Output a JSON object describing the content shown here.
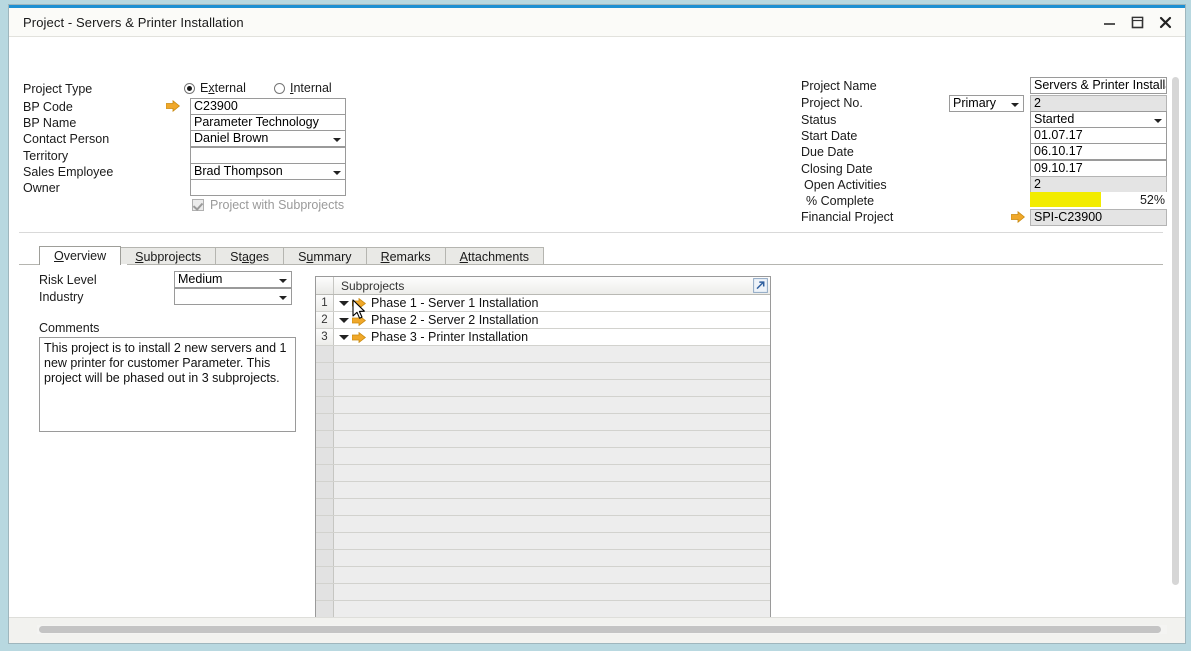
{
  "window": {
    "title": "Project - Servers & Printer Installation",
    "controls": {
      "minimize": "Minimize",
      "maximize": "Maximize",
      "close": "Close"
    },
    "accent_color": "#1e90d2",
    "desktop_color": "#b8d8e0"
  },
  "form_left": {
    "project_type": {
      "label": "Project Type",
      "options": [
        {
          "label": "External",
          "mnemonic": "x",
          "selected": true
        },
        {
          "label": "Internal",
          "mnemonic": "I",
          "selected": false
        }
      ]
    },
    "bp_code": {
      "label": "BP Code",
      "value": "C23900",
      "has_link_arrow": true
    },
    "bp_name": {
      "label": "BP Name",
      "value": "Parameter Technology"
    },
    "contact_person": {
      "label": "Contact Person",
      "value": "Daniel Brown"
    },
    "territory": {
      "label": "Territory",
      "value": ""
    },
    "sales_employee": {
      "label": "Sales Employee",
      "value": "Brad Thompson"
    },
    "owner": {
      "label": "Owner",
      "value": ""
    },
    "project_with_subprojects": {
      "label": "Project with Subprojects",
      "checked": true,
      "disabled": true
    }
  },
  "form_right": {
    "project_name": {
      "label": "Project Name",
      "value": "Servers & Printer Installatio"
    },
    "project_no": {
      "label": "Project No.",
      "type_value": "Primary",
      "value": "2"
    },
    "status": {
      "label": "Status",
      "value": "Started"
    },
    "start_date": {
      "label": "Start Date",
      "value": "01.07.17"
    },
    "due_date": {
      "label": "Due Date",
      "value": "06.10.17"
    },
    "closing_date": {
      "label": "Closing Date",
      "value": "09.10.17"
    },
    "open_activities": {
      "label": "Open Activities",
      "value": "2"
    },
    "percent_complete": {
      "label": "% Complete",
      "value": "52%",
      "percent": 52,
      "bar_color": "#f2ec00"
    },
    "financial_project": {
      "label": "Financial Project",
      "value": "SPI-C23900",
      "has_link_arrow": true
    }
  },
  "tabs": [
    {
      "label": "Overview",
      "mnemonic": "O",
      "active": true
    },
    {
      "label": "Subprojects",
      "mnemonic": "S",
      "active": false
    },
    {
      "label": "Stages",
      "mnemonic": "a",
      "active": false
    },
    {
      "label": "Summary",
      "mnemonic": "u",
      "active": false
    },
    {
      "label": "Remarks",
      "mnemonic": "R",
      "active": false
    },
    {
      "label": "Attachments",
      "mnemonic": "A",
      "active": false
    }
  ],
  "overview": {
    "risk_level": {
      "label": "Risk Level",
      "value": "Medium"
    },
    "industry": {
      "label": "Industry",
      "value": ""
    },
    "comments": {
      "label": "Comments",
      "value": "This project is to install 2 new servers and 1 new printer for customer Parameter. This project will be phased out in 3 subprojects."
    }
  },
  "grid": {
    "header": "Subprojects",
    "expand_icon": "open-in-new-window-icon",
    "rows": [
      {
        "num": "1",
        "name": "Phase 1 - Server 1 Installation"
      },
      {
        "num": "2",
        "name": "Phase 2 - Server 2 Installation"
      },
      {
        "num": "3",
        "name": "Phase 3 - Printer Installation"
      }
    ],
    "empty_row_count": 18
  }
}
